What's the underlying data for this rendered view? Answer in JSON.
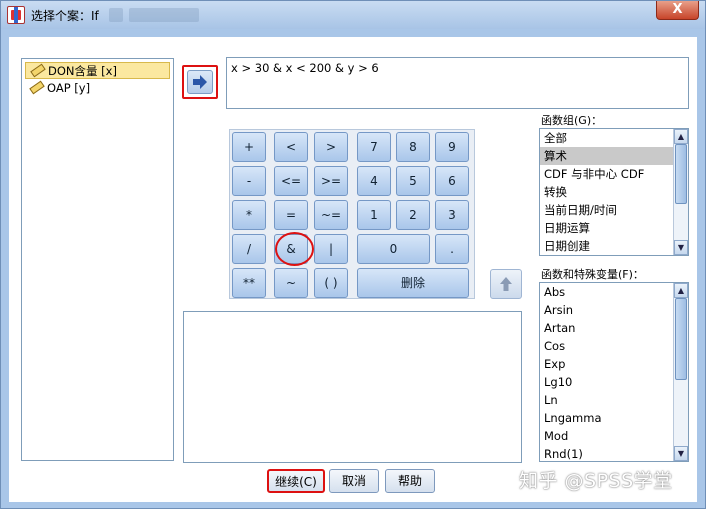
{
  "window": {
    "title": "选择个案：If",
    "close_label": "X"
  },
  "variables": [
    {
      "label": "DON含量 [x]",
      "selected": true,
      "icon": "ruler-icon"
    },
    {
      "label": "OAP [y]",
      "selected": false,
      "icon": "ruler-icon"
    }
  ],
  "expression": "x > 30 & x < 200 & y > 6",
  "keypad": {
    "keys": [
      "+",
      "<",
      ">",
      "7",
      "8",
      "9",
      "-",
      "<=",
      ">=",
      "4",
      "5",
      "6",
      "*",
      "=",
      "~=",
      "1",
      "2",
      "3",
      "/",
      "&",
      "|",
      "0",
      ".",
      "**",
      "~",
      "( )",
      "删除"
    ]
  },
  "function_groups": {
    "label": "函数组(G)：",
    "items": [
      "全部",
      "算术",
      "CDF 与非中心 CDF",
      "转换",
      "当前日期/时间",
      "日期运算",
      "日期创建"
    ],
    "selected": "算术"
  },
  "functions": {
    "label": "函数和特殊变量(F)：",
    "items": [
      "Abs",
      "Arsin",
      "Artan",
      "Cos",
      "Exp",
      "Lg10",
      "Ln",
      "Lngamma",
      "Mod",
      "Rnd(1)"
    ]
  },
  "buttons": {
    "continue": "继续(C)",
    "cancel": "取消",
    "help": "帮助"
  },
  "watermark": "知乎 @SPSS学堂",
  "colors": {
    "highlight_ring": "#dd1111",
    "title_bg": "#a9c6e8"
  }
}
